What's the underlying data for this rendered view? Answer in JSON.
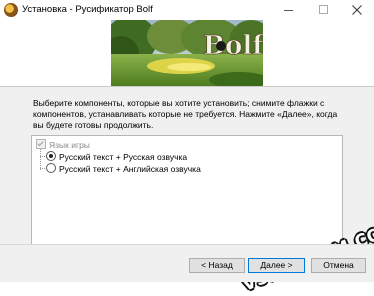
{
  "window": {
    "title": "Установка - Русификатор Bolf",
    "icon": "installer-app-icon"
  },
  "banner": {
    "logo_text": "Bolf"
  },
  "main": {
    "description": "Выберите компоненты, которые вы хотите установить; снимите флажки с компонентов, устанавливать которые не требуется. Нажмите «Далее», когда вы будете готовы продолжить.",
    "components": {
      "group_label": "Язык игры",
      "group_checked": true,
      "options": [
        {
          "label": "Русский текст + Русская озвучка",
          "selected": true
        },
        {
          "label": "Русский текст + Английская озвучка",
          "selected": false
        }
      ]
    }
  },
  "watermark": "VSE-PUTEM.COM",
  "footer": {
    "back_label": "< Назад",
    "next_label": "Далее >",
    "cancel_label": "Отмена"
  },
  "colors": {
    "dialog_bg": "#f0f0f0",
    "default_button_border": "#0078d7"
  }
}
